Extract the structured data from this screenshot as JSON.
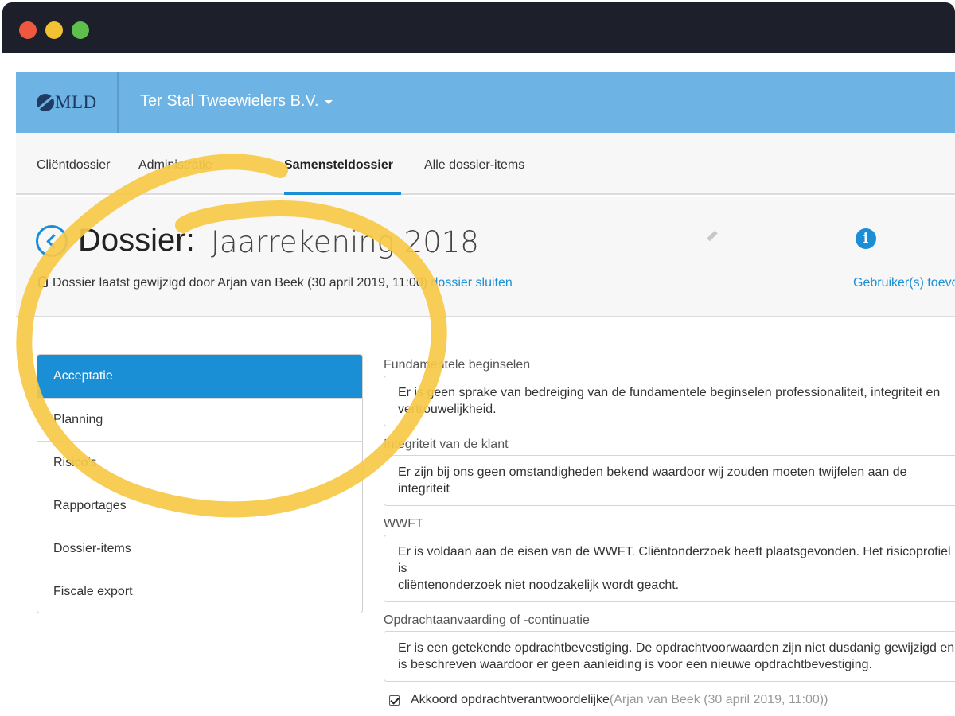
{
  "window": {
    "controls": [
      "close",
      "minimize",
      "maximize"
    ]
  },
  "topnav": {
    "logo_text": "MLD",
    "company": "Ter Stal Tweewielers B.V.",
    "company_icon": "caret-down-icon"
  },
  "tabs": [
    {
      "label": "Cliëntdossier"
    },
    {
      "label": "Administratie"
    },
    {
      "label": "Samensteldossier",
      "active": true
    },
    {
      "label": "Alle dossier-items"
    }
  ],
  "header": {
    "title_prefix": "Dossier:",
    "title_name": "Jaarrekening 2018",
    "meta_text": "Dossier laatst gewijzigd door Arjan van Beek (30 april 2019, 11:00)",
    "close_link": "dossier sluiten",
    "users_link": "Gebruiker(s) toevoegen",
    "info_icon_glyph": "i"
  },
  "side_menu": [
    {
      "label": "Acceptatie",
      "active": true
    },
    {
      "label": "Planning"
    },
    {
      "label": "Risico's"
    },
    {
      "label": "Rapportages"
    },
    {
      "label": "Dossier-items"
    },
    {
      "label": "Fiscale export"
    }
  ],
  "fields": [
    {
      "label": "Fundamentele beginselen",
      "value": "Er is geen sprake van bedreiging van de fundamentele beginselen professionaliteit, integriteit en\nvertrouwelijkheid."
    },
    {
      "label": "Integriteit van de klant",
      "value": "Er zijn bij ons geen omstandigheden bekend waardoor wij zouden moeten twijfelen aan de integriteit"
    },
    {
      "label": "WWFT",
      "value": "Er is voldaan aan de eisen van de WWFT. Cliëntonderzoek heeft plaatsgevonden. Het risicoprofiel is\ncliëntenonderzoek niet noodzakelijk wordt geacht."
    },
    {
      "label": "Opdrachtaanvaarding of -continuatie",
      "value": "Er is een getekende opdrachtbevestiging. De opdrachtvoorwaarden zijn niet dusdanig gewijzigd en\nis beschreven waardoor er geen aanleiding is voor een nieuwe opdrachtbevestiging."
    }
  ],
  "approval": {
    "checked": true,
    "label": "Akkoord opdrachtverantwoordelijke",
    "meta": "(Arjan van Beek (30 april 2019, 11:00))"
  },
  "colors": {
    "window_bar": "#1d1f2b",
    "topnav": "#6db3e4",
    "accent": "#1b8fd6",
    "highlight_scribble": "#f7c948"
  }
}
